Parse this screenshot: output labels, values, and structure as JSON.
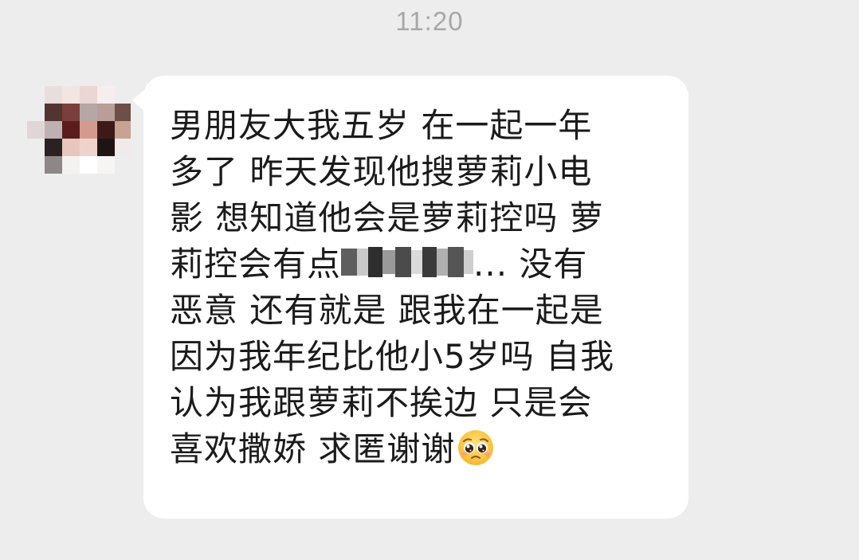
{
  "timestamp": "11:20",
  "message": {
    "line1": "男朋友大我五岁 在一起一年",
    "line2": "多了 昨天发现他搜萝莉小电",
    "line3": "影 想知道他会是萝莉控吗 萝",
    "line4_before": "莉控会有点",
    "line4_after": "... 没有",
    "line5": "恶意 还有就是 跟我在一起是",
    "line6": "因为我年纪比他小5岁吗 自我",
    "line7": "认为我跟萝莉不挨边 只是会",
    "line8": "喜欢撒娇 求匿谢谢",
    "emoji": "pleading-face-icon"
  },
  "colors": {
    "background": "#ededed",
    "bubble": "#ffffff",
    "text": "#1b1b1b",
    "timestamp": "#a8a8a8"
  }
}
